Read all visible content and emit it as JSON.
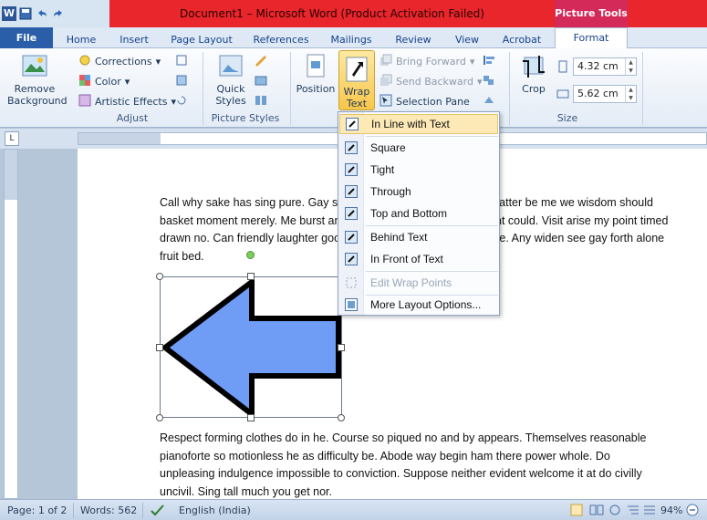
{
  "titlebar": {
    "document_title": "Document1  –  Microsoft Word (Product Activation Failed)",
    "context_tab": "Picture Tools"
  },
  "tabs": [
    "File",
    "Home",
    "Insert",
    "Page Layout",
    "References",
    "Mailings",
    "Review",
    "View",
    "Acrobat",
    "Format"
  ],
  "ribbon": {
    "remove_background": "Remove Background",
    "corrections": "Corrections",
    "color": "Color",
    "artistic_effects": "Artistic Effects",
    "adjust_label": "Adjust",
    "quick_styles": "Quick Styles",
    "picture_styles_label": "Picture Styles",
    "position": "Position",
    "wrap_text": "Wrap Text",
    "bring_forward": "Bring Forward",
    "send_backward": "Send Backward",
    "selection_pane": "Selection Pane",
    "crop": "Crop",
    "height": "4.32 cm",
    "width": "5.62 cm",
    "size_label": "Size"
  },
  "wrap_menu": {
    "items": [
      {
        "label": "In Line with Text",
        "enabled": true
      },
      {
        "label": "Square",
        "enabled": true
      },
      {
        "label": "Tight",
        "enabled": true
      },
      {
        "label": "Through",
        "enabled": true
      },
      {
        "label": "Top and Bottom",
        "enabled": true
      },
      {
        "label": "Behind Text",
        "enabled": true
      },
      {
        "label": "In Front of Text",
        "enabled": true
      },
      {
        "label": "Edit Wrap Points",
        "enabled": false
      },
      {
        "label": "More Layout Options...",
        "enabled": true
      }
    ]
  },
  "document": {
    "para1_lines": [
      "Call why sake has sing pure. Gay six set polite nature worthy. So matter be me we wisdom should",
      "basket moment merely. Me burst ample wholly at for. You of moment could. Visit arise my point timed",
      "drawn no. Can friendly laughter goodness man him appetite carriage. Any widen see gay forth alone",
      "fruit bed."
    ],
    "para2_lines": [
      "Respect forming clothes do in he. Course so piqued no and by appears. Themselves reasonable",
      "pianoforte so motionless he as difficulty be. Abode way begin ham there power whole. Do",
      "unpleasing indulgence impossible to conviction. Suppose neither evident welcome it at do civilly",
      "uncivil.  Sing tall much you get nor."
    ],
    "arrow_fill": "#6f9cf5",
    "arrow_stroke": "#000000"
  },
  "statusbar": {
    "page": "Page: 1 of 2",
    "words": "Words: 562",
    "language": "English (India)",
    "zoom": "94%"
  },
  "colors": {
    "title_red": "#e8262c",
    "context_pink": "#d32a5a",
    "file_blue": "#2a5ea8"
  }
}
